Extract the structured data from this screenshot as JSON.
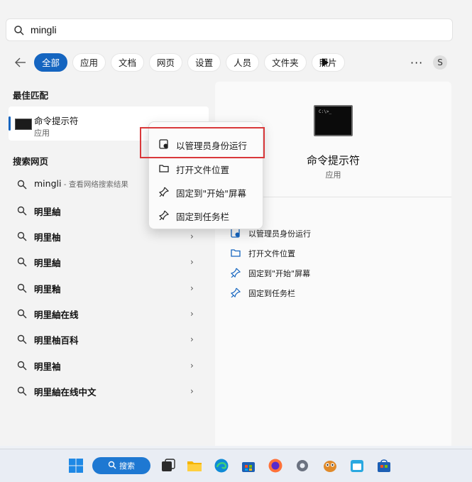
{
  "search": {
    "query": "mingli"
  },
  "filters": {
    "items": [
      "全部",
      "应用",
      "文档",
      "网页",
      "设置",
      "人员",
      "文件夹",
      "照片"
    ],
    "active_index": 0,
    "more": "···",
    "avatar_letter": "S"
  },
  "best_match": {
    "heading": "最佳匹配",
    "title": "命令提示符",
    "subtitle": "应用"
  },
  "web": {
    "heading": "搜索网页",
    "first": {
      "query": "mingli",
      "hint": " - 查看网络搜索结果"
    },
    "items": [
      "明里紬",
      "明里柚",
      "明里紬",
      "明里釉",
      "明里紬在线",
      "明里柚百科",
      "明里袖",
      "明里紬在线中文"
    ],
    "chevron": "›"
  },
  "context_menu": {
    "items": [
      "以管理员身份运行",
      "打开文件位置",
      "固定到\"开始\"屏幕",
      "固定到任务栏"
    ]
  },
  "right_panel": {
    "title": "命令提示符",
    "subtitle": "应用",
    "actions": [
      "以管理员身份运行",
      "打开文件位置",
      "固定到\"开始\"屏幕",
      "固定到任务栏"
    ]
  },
  "taskbar": {
    "search_label": "搜索",
    "icons": [
      "windows-start-icon",
      "task-view-icon",
      "file-explorer-icon",
      "edge-icon",
      "store-icon",
      "firefox-icon",
      "settings-gear-icon",
      "app-owl-icon",
      "calendar-icon",
      "store-bag-icon"
    ]
  },
  "colors": {
    "accent": "#1565c0",
    "highlight": "#d9383a"
  }
}
